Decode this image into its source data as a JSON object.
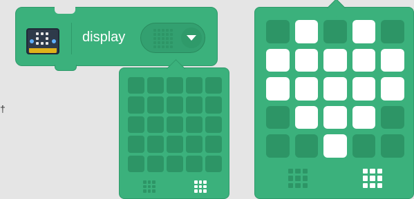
{
  "stray_mark": "†",
  "block": {
    "label": "display",
    "icon": "microbit-extension-icon",
    "dropdown_icon": "led-matrix-icon",
    "caret_icon": "chevron-down-icon"
  },
  "colors": {
    "block_green": "#3bb17c",
    "led_off": "#2d9566",
    "led_on": "#ffffff",
    "background": "#e5e5e5"
  },
  "popup_small": {
    "leds": [
      [
        0,
        0,
        0,
        0,
        0
      ],
      [
        0,
        0,
        0,
        0,
        0
      ],
      [
        0,
        0,
        0,
        0,
        0
      ],
      [
        0,
        0,
        0,
        0,
        0
      ],
      [
        0,
        0,
        0,
        0,
        0
      ]
    ],
    "footer": [
      {
        "icon": "clear-all-icon",
        "state": "off"
      },
      {
        "icon": "fill-all-icon",
        "state": "on"
      }
    ]
  },
  "popup_large": {
    "leds": [
      [
        0,
        1,
        0,
        1,
        0
      ],
      [
        1,
        1,
        1,
        1,
        1
      ],
      [
        1,
        1,
        1,
        1,
        1
      ],
      [
        0,
        1,
        1,
        1,
        0
      ],
      [
        0,
        0,
        1,
        0,
        0
      ]
    ],
    "footer": [
      {
        "icon": "clear-all-icon",
        "state": "off"
      },
      {
        "icon": "fill-all-icon",
        "state": "on"
      }
    ]
  }
}
